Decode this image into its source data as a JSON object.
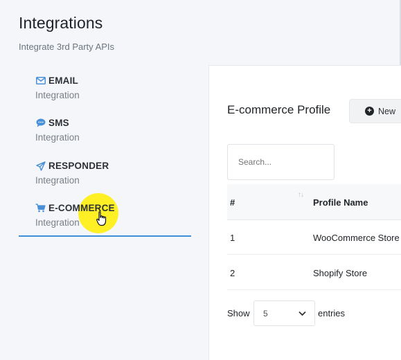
{
  "header": {
    "title": "Integrations",
    "subtitle": "Integrate 3rd Party APIs"
  },
  "sidebar": {
    "items": [
      {
        "label": "EMAIL",
        "sub": "Integration",
        "icon": "envelope-icon"
      },
      {
        "label": "SMS",
        "sub": "Integration",
        "icon": "chat-bubble-icon"
      },
      {
        "label": "RESPONDER",
        "sub": "Integration",
        "icon": "paper-plane-icon"
      },
      {
        "label": "E-COMMERCE",
        "sub": "Integration",
        "icon": "shopping-cart-icon",
        "active": true
      }
    ]
  },
  "main": {
    "title": "E-commerce Profile",
    "new_button": "New",
    "search_placeholder": "Search...",
    "table": {
      "columns": [
        "#",
        "Profile Name"
      ],
      "rows": [
        {
          "num": "1",
          "name": "WooCommerce Store"
        },
        {
          "num": "2",
          "name": "Shopify Store"
        }
      ]
    },
    "pagination": {
      "show_label": "Show",
      "entries_value": "5",
      "entries_label": "entries"
    }
  },
  "colors": {
    "accent": "#3f8fd8",
    "icon": "#4a90d9",
    "cursor_highlight": "#ffef00"
  }
}
